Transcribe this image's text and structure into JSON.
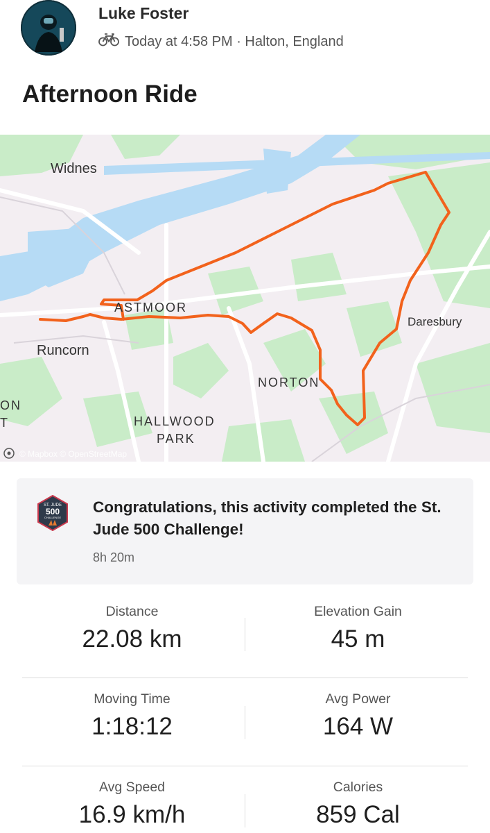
{
  "header": {
    "athlete_name": "Luke Foster",
    "meta_text": "Today at 4:58 PM · Halton, England",
    "activity_icon": "bike-icon"
  },
  "activity": {
    "title": "Afternoon Ride"
  },
  "map": {
    "labels": {
      "widnes": "Widnes",
      "runcorn": "Runcorn",
      "astmoor": "ASTMOOR",
      "norton": "NORTON",
      "daresbury": "Daresbury",
      "hallwood": "HALLWOOD",
      "park": "PARK",
      "on": "ON",
      "t": "T"
    },
    "attribution": "© Mapbox © OpenStreetMap",
    "route_color": "#f2621c"
  },
  "achievement": {
    "badge_top": "ST. JUDE",
    "badge_number": "500",
    "badge_bottom": "CHALLENGE",
    "text": "Congratulations, this activity completed the St. Jude 500 Challenge!",
    "time": "8h 20m"
  },
  "stats": [
    {
      "label": "Distance",
      "value": "22.08 km"
    },
    {
      "label": "Elevation Gain",
      "value": "45 m"
    },
    {
      "label": "Moving Time",
      "value": "1:18:12"
    },
    {
      "label": "Avg Power",
      "value": "164 W"
    },
    {
      "label": "Avg Speed",
      "value": "16.9 km/h"
    },
    {
      "label": "Calories",
      "value": "859 Cal"
    }
  ]
}
